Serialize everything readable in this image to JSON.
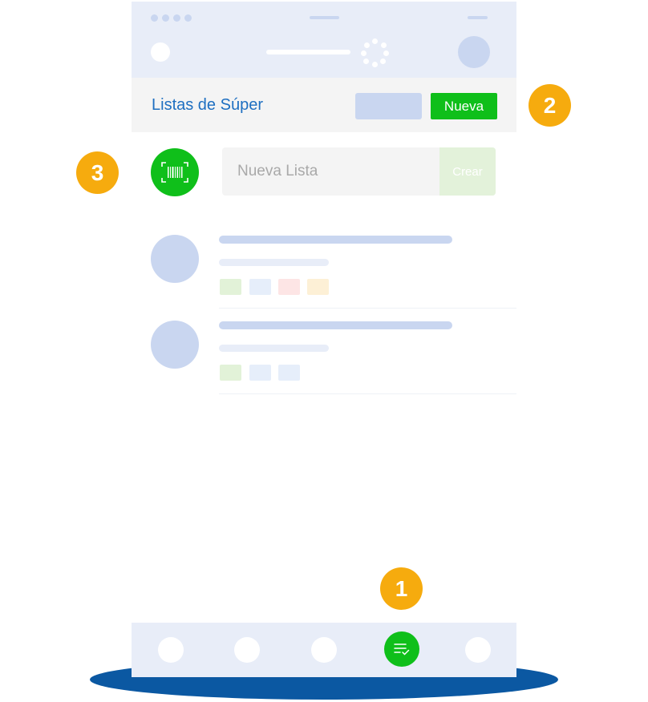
{
  "header": {
    "title": "Listas de Súper",
    "new_button_label": "Nueva"
  },
  "new_list": {
    "placeholder": "Nueva Lista",
    "value": "",
    "create_button_label": "Crear"
  },
  "callouts": {
    "nav": "1",
    "new_button": "2",
    "scan": "3"
  },
  "icons": {
    "scan": "barcode-scan-icon",
    "nav_active": "checklist-icon"
  },
  "colors": {
    "accent_green": "#0fbf1a",
    "title_blue": "#1e6fc1",
    "callout_orange": "#f6ab0e",
    "skeleton": "#c9d6f0",
    "bar_background": "#e8edf8",
    "ellipse_blue": "#0b58a2"
  },
  "skeleton_rows": [
    {
      "chips": [
        "#e2f2d8",
        "#e6eefa",
        "#fde5e5",
        "#fdf0d6"
      ]
    },
    {
      "chips": [
        "#e2f2d8",
        "#e6eefa",
        "#e6eefa"
      ]
    }
  ]
}
